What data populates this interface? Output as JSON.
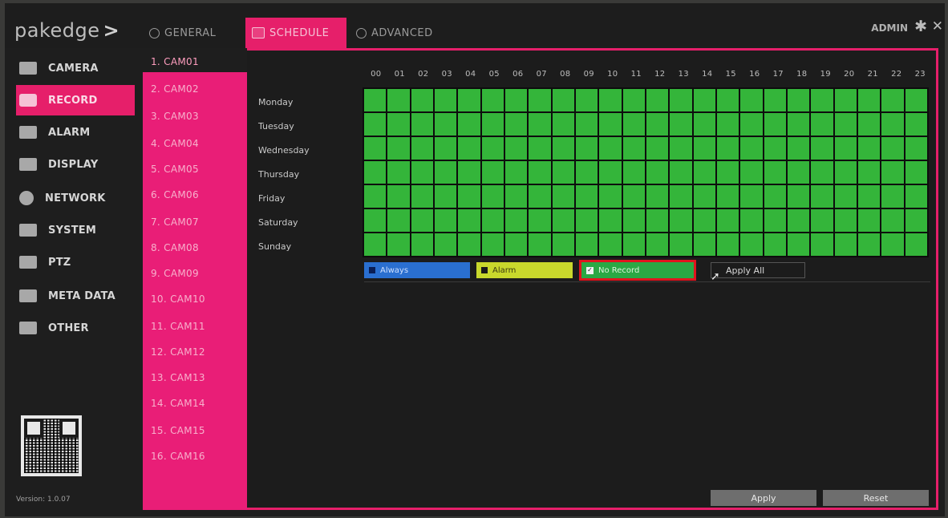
{
  "topbar": {
    "logo": "pakedge",
    "tabs": [
      {
        "label": "GENERAL"
      },
      {
        "label": "SCHEDULE"
      },
      {
        "label": "ADVANCED"
      }
    ],
    "user": "ADMIN",
    "icons": {
      "settings": "gear-icon",
      "close": "close-icon"
    }
  },
  "sidebar": {
    "items": [
      {
        "label": "CAMERA",
        "icon": "camera-icon"
      },
      {
        "label": "RECORD",
        "icon": "record-icon"
      },
      {
        "label": "ALARM",
        "icon": "alarm-icon"
      },
      {
        "label": "DISPLAY",
        "icon": "monitor-icon"
      },
      {
        "label": "NETWORK",
        "icon": "globe-icon"
      },
      {
        "label": "SYSTEM",
        "icon": "server-icon"
      },
      {
        "label": "PTZ",
        "icon": "ptz-joystick-icon"
      },
      {
        "label": "META DATA",
        "icon": "metadata-icon"
      },
      {
        "label": "OTHER",
        "icon": "other-icon"
      }
    ],
    "active_index": 1,
    "version": "Version: 1.0.07"
  },
  "cameras": [
    "1. CAM01",
    "2. CAM02",
    "3. CAM03",
    "4. CAM04",
    "5. CAM05",
    "6. CAM06",
    "7. CAM07",
    "8. CAM08",
    "9. CAM09",
    "10. CAM10",
    "11. CAM11",
    "12. CAM12",
    "13. CAM13",
    "14. CAM14",
    "15. CAM15",
    "16. CAM16"
  ],
  "schedule": {
    "hours": [
      "00",
      "01",
      "02",
      "03",
      "04",
      "05",
      "06",
      "07",
      "08",
      "09",
      "10",
      "11",
      "12",
      "13",
      "14",
      "15",
      "16",
      "17",
      "18",
      "19",
      "20",
      "21",
      "22",
      "23"
    ],
    "days": [
      "Monday",
      "Tuesday",
      "Wednesday",
      "Thursday",
      "Friday",
      "Saturday",
      "Sunday"
    ],
    "cell_state": "No Record",
    "colors": {
      "always": "#2a6fd0",
      "alarm": "#c9d82c",
      "no_record": "#34b53a",
      "accent": "#e61f6a",
      "highlight": "#e0141e"
    }
  },
  "legend": {
    "always": "Always",
    "alarm": "Alarm",
    "no_record": "No Record",
    "no_record_checked": true,
    "apply_all": "Apply All"
  },
  "footer": {
    "apply": "Apply",
    "reset": "Reset"
  }
}
